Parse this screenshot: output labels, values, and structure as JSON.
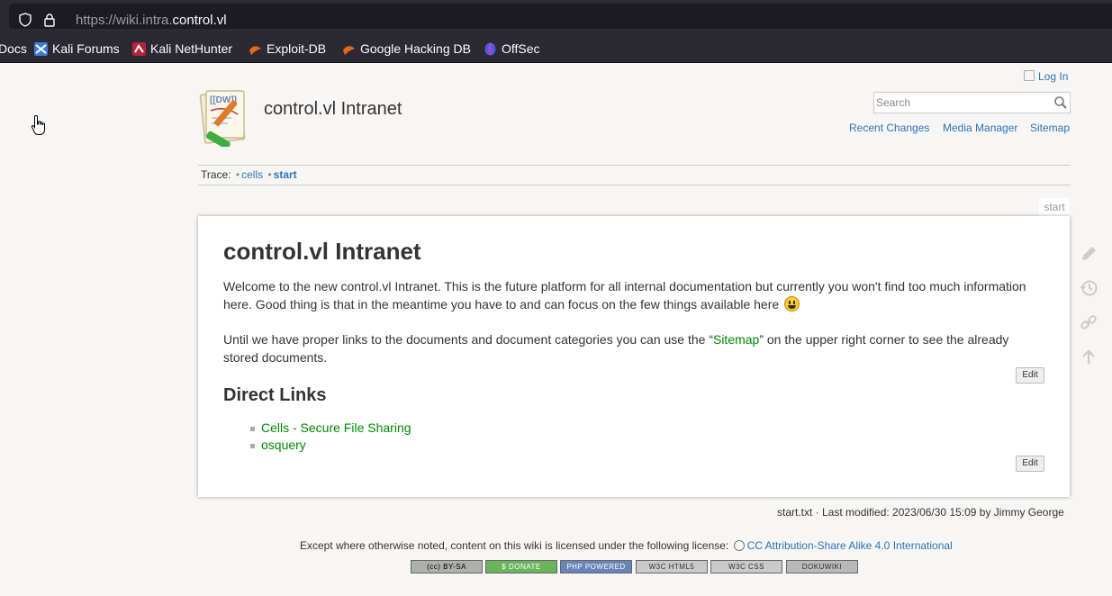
{
  "browser": {
    "url_prefix": "https://wiki.intra.",
    "url_domain": "control.vl",
    "bookmarks": [
      {
        "label": "Docs"
      },
      {
        "label": "Kali Forums"
      },
      {
        "label": "Kali NetHunter"
      },
      {
        "label": "Exploit-DB"
      },
      {
        "label": "Google Hacking DB"
      },
      {
        "label": "OffSec"
      }
    ]
  },
  "header": {
    "site_title": "control.vl Intranet",
    "login_label": "Log In",
    "search_placeholder": "Search",
    "tools": [
      "Recent Changes",
      "Media Manager",
      "Sitemap"
    ]
  },
  "breadcrumb": {
    "label": "Trace:",
    "items": [
      "cells",
      "start"
    ]
  },
  "page": {
    "tab_label": "start",
    "title": "control.vl Intranet",
    "para1": "Welcome to the new control.vl Intranet. This is the future platform for all internal documentation but currently you won't find too much information here. Good thing is that in the meantime you have to and can focus on the few things available here",
    "para2_before": "Until we have proper links to the documents and document categories you can use the “",
    "para2_link": "Sitemap",
    "para2_after": "” on the upper right corner to see the already stored documents.",
    "edit_label": "Edit",
    "section_title": "Direct Links",
    "links": [
      "Cells - Secure File Sharing",
      "osquery"
    ]
  },
  "footer": {
    "docinfo": "start.txt · Last modified: 2023/06/30 15:09 by Jimmy George",
    "license_text": "Except where otherwise noted, content on this wiki is licensed under the following license:",
    "license_link": "CC Attribution-Share Alike 4.0 International",
    "badges": [
      "(cc) BY-SA",
      "$ DONATE",
      "PHP POWERED",
      "W3C HTML5",
      "W3C CSS",
      "DOKUWIKI"
    ]
  },
  "colors": {
    "link_blue": "#2b73b7",
    "wiki_link_green": "#008800",
    "chrome_bg": "#2b2a33"
  }
}
